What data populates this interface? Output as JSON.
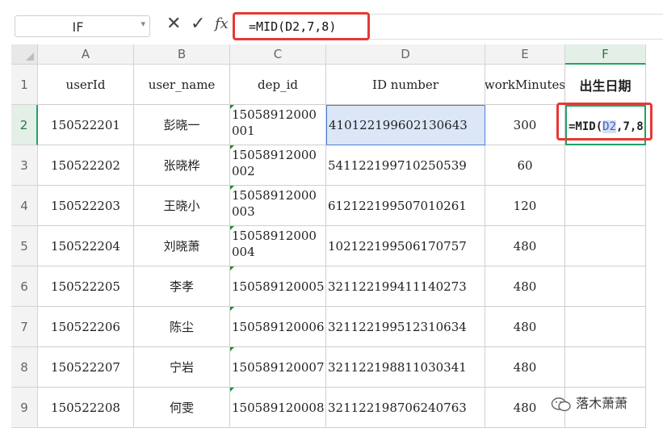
{
  "formula_bar": {
    "name_box": "IF",
    "cancel_icon": "✕",
    "enter_icon": "✓",
    "fx_label": "fx",
    "formula": "=MID(D2,7,8)"
  },
  "columns": [
    "A",
    "B",
    "C",
    "D",
    "E",
    "F"
  ],
  "active_column": "F",
  "rows": [
    "1",
    "2",
    "3",
    "4",
    "5",
    "6",
    "7",
    "8",
    "9"
  ],
  "active_row": "2",
  "headers": {
    "A": "userId",
    "B": "user_name",
    "C": "dep_id",
    "D": "ID number",
    "E": "workMinutes",
    "F": "出生日期"
  },
  "data_rows": [
    {
      "A": "150522201",
      "B": "彭晓一",
      "C": "15058912000001",
      "D": "410122199602130643",
      "E": "300",
      "F": ""
    },
    {
      "A": "150522202",
      "B": "张晓桦",
      "C": "15058912000002",
      "D": "541122199710250539",
      "E": "60",
      "F": ""
    },
    {
      "A": "150522203",
      "B": "王晓小",
      "C": "15058912000003",
      "D": "612122199507010261",
      "E": "120",
      "F": ""
    },
    {
      "A": "150522204",
      "B": "刘晓萧",
      "C": "15058912000004",
      "D": "102122199506170757",
      "E": "480",
      "F": ""
    },
    {
      "A": "150522205",
      "B": "李孝",
      "C": "150589120005",
      "D": "321122199411140273",
      "E": "480",
      "F": ""
    },
    {
      "A": "150522206",
      "B": "陈尘",
      "C": "150589120006",
      "D": "321122199512310634",
      "E": "480",
      "F": ""
    },
    {
      "A": "150522207",
      "B": "宁岩",
      "C": "150589120007",
      "D": "321122198811030341",
      "E": "480",
      "F": ""
    },
    {
      "A": "150522208",
      "B": "何雯",
      "C": "150589120008",
      "D": "321122198706240763",
      "E": "480",
      "F": ""
    }
  ],
  "editing_cell": {
    "prefix": "=MID(",
    "ref": "D2",
    "suffix": ",7,8"
  },
  "watermark": "落木萧萧",
  "colors": {
    "highlight_red": "#e53935",
    "active_green": "#21a366",
    "selection_blue": "#dbe6f7"
  }
}
